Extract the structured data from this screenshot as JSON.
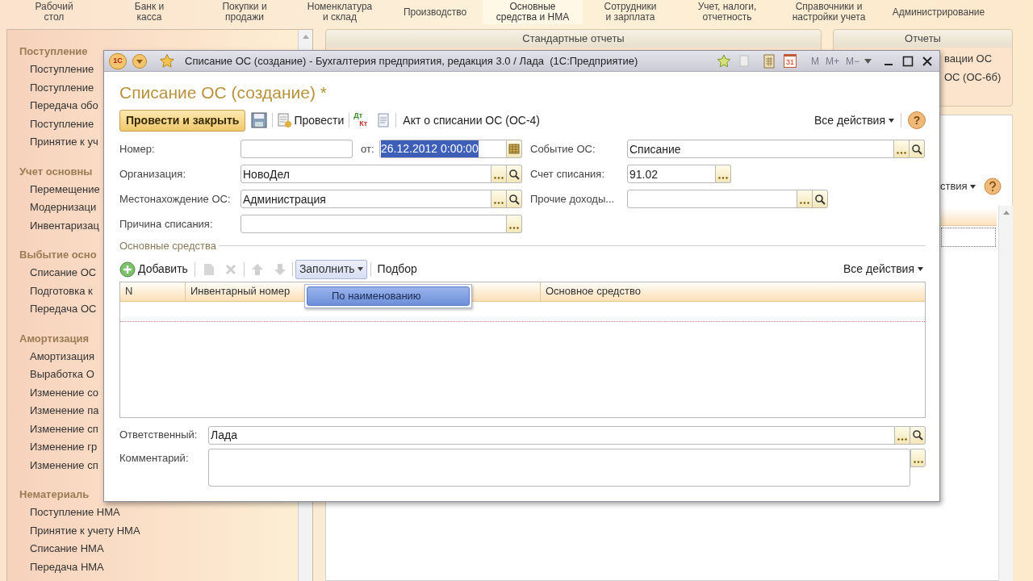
{
  "nav": [
    {
      "label": "Рабочий\nстол",
      "selected": false
    },
    {
      "label": "Банк и\nкасса",
      "selected": false
    },
    {
      "label": "Покупки и\nпродажи",
      "selected": false
    },
    {
      "label": "Номенклатура\nи склад",
      "selected": false
    },
    {
      "label": "Производство",
      "selected": false
    },
    {
      "label": "Основные\nсредства и НМА",
      "selected": true
    },
    {
      "label": "Сотрудники\nи зарплата",
      "selected": false
    },
    {
      "label": "Учет, налоги,\nотчетность",
      "selected": false
    },
    {
      "label": "Справочники и\nнастройки учета",
      "selected": false
    },
    {
      "label": "Администрирование",
      "selected": false
    }
  ],
  "sidebar": {
    "groups": [
      {
        "title": "Поступление",
        "children": [
          "Поступление",
          "Поступление",
          "Передача обо",
          "Поступление",
          "Принятие к уч"
        ]
      },
      {
        "title": "Учет основны",
        "children": [
          "Перемещение",
          "Модернизаци",
          "Инвентаризац"
        ]
      },
      {
        "title": "Выбытие осно",
        "children": [
          "Списание ОС",
          "Подготовка к",
          "Передача ОС"
        ]
      },
      {
        "title": "Амортизация",
        "children": [
          "Амортизация",
          "Выработка О",
          "Изменение со",
          "Изменение па",
          "Изменение сп",
          "Изменение гр",
          "Изменение сп"
        ]
      },
      {
        "title": "Нематериаль",
        "children": [
          "Поступление НМА",
          "Принятие к учету НМА",
          "Списание НМА",
          "Передача НМА"
        ]
      }
    ]
  },
  "reports": {
    "standard_title": "Стандартные отчеты",
    "title": "Отчеты",
    "items": [
      "вации ОС",
      "ОС (ОС-6б)"
    ]
  },
  "list": {
    "actions": "ствия"
  },
  "dialog": {
    "logo": "1С",
    "title": "Списание ОС (создание) - Бухгалтерия предприятия, редакция 3.0 / Лада  (1С:Предприятие)",
    "calendar_day": "31",
    "memory": [
      "M",
      "M+",
      "M−"
    ],
    "form_title": "Списание ОС (создание) *",
    "toolbar": {
      "primary": "Провести и закрыть",
      "post": "Провести",
      "dt": "Дт",
      "kt": "Кт",
      "print": "Акт о списании ОС (ОС-4)",
      "all_actions": "Все действия",
      "help": "?"
    },
    "fields": [
      {
        "label": "Номер:",
        "kind": "plain"
      },
      {
        "label": "от:",
        "value": "26.12.2012  0:00:00",
        "kind": "date",
        "highlighted": true
      },
      {
        "label": "Событие ОС:",
        "value": "Списание",
        "kind": "lookup"
      },
      {
        "label": "Организация:",
        "value": "НовоДел",
        "kind": "lookup"
      },
      {
        "label": "Счет списания:",
        "value": "91.02",
        "kind": "choice"
      },
      {
        "label": "Местонахождение ОС:",
        "value": "Администрация",
        "kind": "lookup"
      },
      {
        "label": "Прочие доходы...",
        "kind": "lookup"
      },
      {
        "label": "Причина списания:",
        "kind": "choice"
      }
    ],
    "section_title": "Основные средства",
    "table_toolbar": {
      "add": "Добавить",
      "fill": "Заполнить",
      "fill_expanded": true,
      "pick": "Подбор",
      "all_actions": "Все действия"
    },
    "fill_menu": [
      {
        "label": "По наименованию",
        "selected": true
      }
    ],
    "columns": [
      "N",
      "Инвентарный номер",
      "Основное средство"
    ],
    "responsible": {
      "label": "Ответственный:",
      "value": "Лада",
      "kind": "lookup"
    },
    "comment": {
      "label": "Комментарий:"
    }
  }
}
